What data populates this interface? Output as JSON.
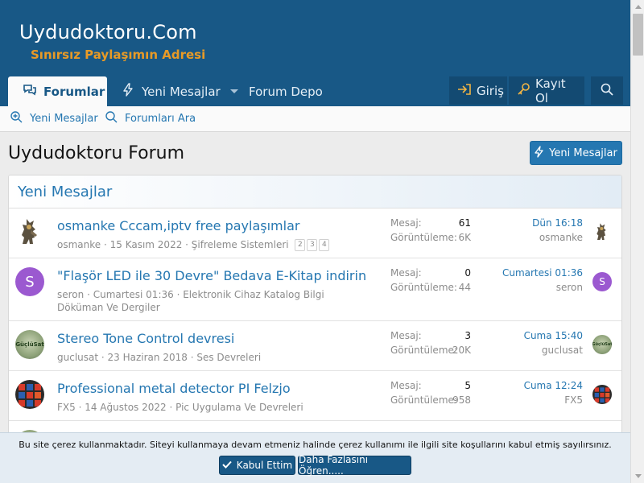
{
  "header": {
    "logo_title": "Uydudoktoru.Com",
    "logo_slogan": "Sınırsız Paylaşımın Adresi"
  },
  "nav": {
    "forums_label": "Forumlar",
    "new_posts_label": "Yeni Mesajlar",
    "forum_depo_label": "Forum Depo",
    "login_label": "Giriş",
    "register_label": "Kayıt Ol"
  },
  "subnav": {
    "new_posts_label": "Yeni Mesajlar",
    "search_forums_label": "Forumları Ara"
  },
  "main": {
    "page_title": "Uydudoktoru Forum",
    "new_posts_button": "Yeni Mesajlar",
    "block_title": "Yeni Mesajlar",
    "replies_label": "Mesaj:",
    "views_label": "Görüntüleme:",
    "threads": [
      {
        "title": "osmanke Cccam,iptv free paylaşımlar",
        "starter": "osmanke",
        "start_date": "15 Kasım 2022",
        "forum": "Şifreleme Sistemleri",
        "pages": [
          "2",
          "3",
          "4"
        ],
        "replies": "61",
        "views": "6K",
        "last_date": "Dün 16:18",
        "last_user": "osmanke",
        "avatar": "warrior"
      },
      {
        "title": "\"Flaşör LED ile 30 Devre\" Bedava E-Kitap indirin",
        "starter": "seron",
        "start_date": "Cumartesi 01:36",
        "forum": "Elektronik Cihaz Katalog Bilgi Döküman Ve Dergiler",
        "pages": [],
        "replies": "0",
        "views": "44",
        "last_date": "Cumartesi 01:36",
        "last_user": "seron",
        "avatar": "S"
      },
      {
        "title": "Stereo Tone Control devresi",
        "starter": "guclusat",
        "start_date": "23 Haziran 2018",
        "forum": "Ses Devreleri",
        "pages": [],
        "replies": "3",
        "views": "20K",
        "last_date": "Cuma 15:40",
        "last_user": "guclusat",
        "avatar": "GüçlüSat"
      },
      {
        "title": "Professional metal detector PI Felzjo",
        "starter": "FX5",
        "start_date": "14 Ağustos 2022",
        "forum": "Pic Uygulama Ve Devreleri",
        "pages": [],
        "replies": "5",
        "views": "958",
        "last_date": "Cuma 12:24",
        "last_user": "FX5",
        "avatar": "cubes"
      }
    ]
  },
  "cookie": {
    "text": "Bu site çerez kullanmaktadır. Siteyi kullanmaya devam etmeniz halinde çerez kullanımı ile ilgili site koşullarını kabul etmiş sayılırsınız.",
    "accept_label": "Kabul Ettim",
    "more_label": "Daha Fazlasını Öğren....."
  },
  "colors": {
    "header_bg": "#185886",
    "accent_link": "#2577b1",
    "slogan": "#e89a26",
    "avatar_purple": "#9b59d0"
  }
}
